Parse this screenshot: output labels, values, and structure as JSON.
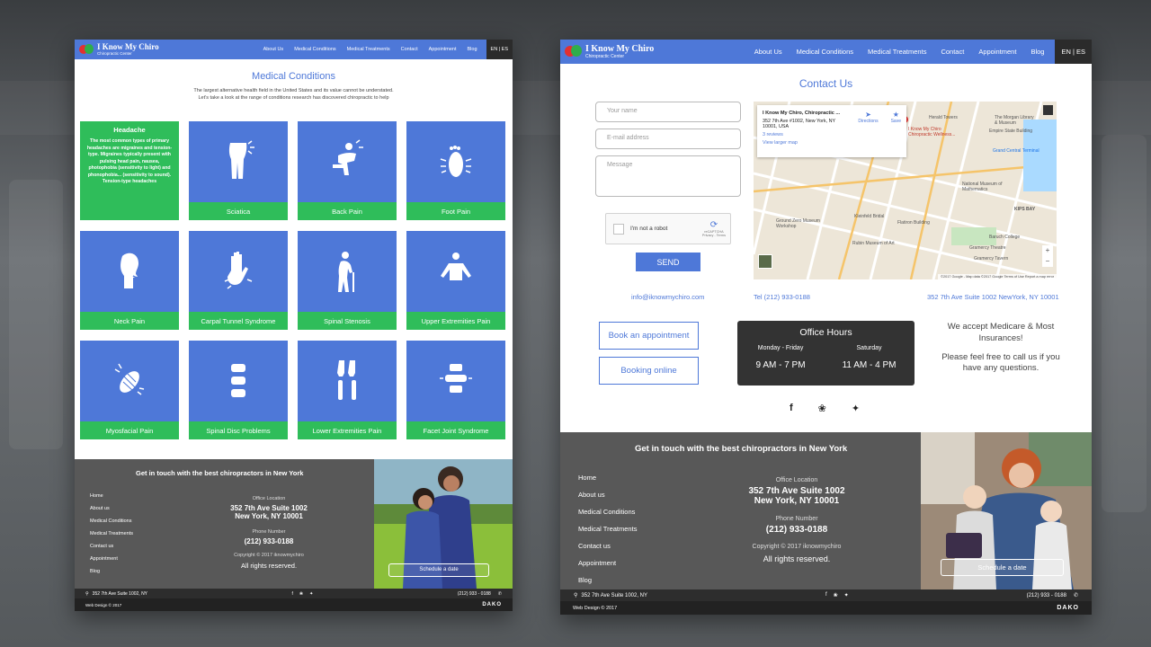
{
  "left": {
    "brand": {
      "name": "I Know My Chiro",
      "sub": "Chiropractic Center"
    },
    "nav": [
      "About Us",
      "Medical Conditions",
      "Medical Treatments",
      "Contact",
      "Appointment",
      "Blog"
    ],
    "lang": "EN | ES",
    "title": "Medical Conditions",
    "intro": "The largest alternative health field in the United States and its value cannot be understated. Let’s take a look at the range of conditions research has discovered chiropractic to help",
    "headache": {
      "title": "Headache",
      "desc": "The most common types of primary headaches are migraines and tension-type. Migraines typically present with pulsing head pain, nausea, photophobia (sensitivity to light) and phonophobia... (sensitivity to sound). Tension-type headaches"
    },
    "cards": [
      "Sciatica",
      "Back Pain",
      "Foot Pain",
      "Neck Pain",
      "Carpal Tunnel Syndrome",
      "Spinal Stenosis",
      "Upper Extremities Pain",
      "Myosfacial Pain",
      "Spinal Disc Problems",
      "Lower Extremities Pain",
      "Facet Joint Syndrome"
    ],
    "footer": {
      "tagline": "Get in touch with the best chiropractors in New York",
      "links": [
        "Home",
        "About us",
        "Medical Conditions",
        "Medical Treatments",
        "Contact us",
        "Appointment",
        "Blog"
      ],
      "office_label": "Office Location",
      "office_line1": "352 7th Ave Suite 1002",
      "office_line2": "New York, NY 10001",
      "phone_label": "Phone Number",
      "phone": "(212) 933-0188",
      "copyright": "Copyright © 2017 iknowmychiro",
      "rights": "All rights reserved.",
      "schedule": "Schedule a date"
    },
    "bottom": {
      "address": "352 7th Ave Suite 1002, NY",
      "phone": "(212) 933 - 0188",
      "credit": "Web Design © 2017",
      "studio": "DAKO"
    }
  },
  "right": {
    "brand": {
      "name": "I Know My Chiro",
      "sub": "Chiropractic Center"
    },
    "nav": [
      "About Us",
      "Medical Conditions",
      "Medical Treatments",
      "Contact",
      "Appointment",
      "Blog"
    ],
    "lang": "EN | ES",
    "title": "Contact Us",
    "form": {
      "name_ph": "Your name",
      "email_ph": "E-mail address",
      "message_ph": "Message",
      "captcha": "I'm not a robot",
      "captcha_brand": "reCAPTCHA",
      "captcha_terms": "Privacy - Terms",
      "send": "SEND"
    },
    "map": {
      "place": "I Know My Chiro, Chiropractic ...",
      "address1": "352 7th Ave #1002, New York, NY",
      "address2": "10001, USA",
      "reviews": "3 reviews",
      "larger": "View larger map",
      "directions": "Directions",
      "save": "Save",
      "pin_label": "I Know My Chiro Chiropractic Wellness...",
      "labels": [
        "Herald Towers",
        "The Morgan Library & Museum",
        "Empire State Building",
        "Grand Central Terminal",
        "National Museum of Mathematics",
        "KIPS BAY",
        "Ground Zero Museum Workshop",
        "Kleinfeld Bridal",
        "Flatiron Building",
        "Baruch College",
        "Rubin Museum of Art",
        "Gramercy Theatre",
        "Gramercy Tavern"
      ],
      "footer": "©2017 Google - Map data ©2017 Google   Terms of Use   Report a map error"
    },
    "contact": {
      "email": "info@iknowmychiro.com",
      "tel": "Tel (212) 933-0188",
      "address": "352 7th Ave Suite 1002 NewYork, NY 10001"
    },
    "buttons": {
      "book": "Book an appointment",
      "online": "Booking online"
    },
    "hours": {
      "title": "Office Hours",
      "d1": "Monday - Friday",
      "h1": "9 AM - 7 PM",
      "d2": "Saturday",
      "h2": "11 AM - 4 PM"
    },
    "medicare": {
      "line1": "We accept Medicare & Most Insurances!",
      "line2": "Please feel free to call us if you have any questions."
    },
    "footer": {
      "tagline": "Get in touch with the best chiropractors in New York",
      "links": [
        "Home",
        "About us",
        "Medical Conditions",
        "Medical Treatments",
        "Contact us",
        "Appointment",
        "Blog"
      ],
      "office_label": "Office Location",
      "office_line1": "352 7th Ave Suite 1002",
      "office_line2": "New York, NY 10001",
      "phone_label": "Phone Number",
      "phone": "(212) 933-0188",
      "copyright": "Copyright © 2017 iknowmychiro",
      "rights": "All rights reserved.",
      "schedule": "Schedule a date"
    },
    "bottom": {
      "address": "352 7th Ave Suite 1002, NY",
      "phone": "(212) 933 - 0188",
      "credit": "Web Design © 2017",
      "studio": "DAKO"
    }
  },
  "colors": {
    "brand_blue": "#4e78d8",
    "green": "#2fbd5a",
    "dark": "#333333",
    "footer_gray": "#585858"
  }
}
